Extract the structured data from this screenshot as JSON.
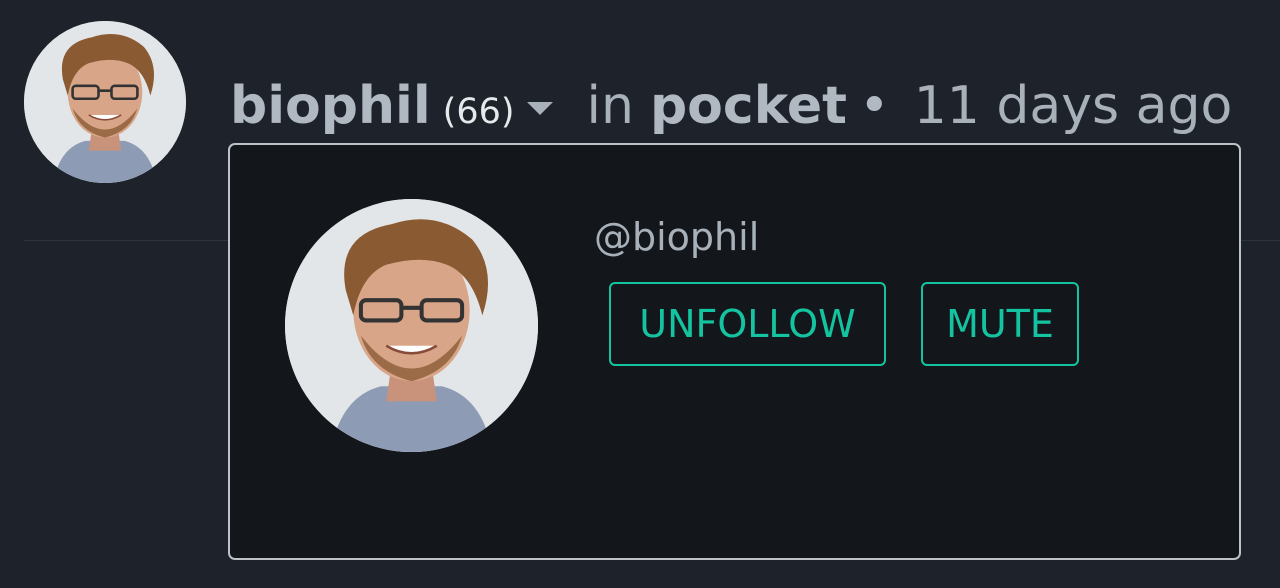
{
  "post_header": {
    "author": "biophil",
    "reputation": "(66)",
    "in_label": "in",
    "community": "pocket",
    "separator_dot": "•",
    "timestamp": "11 days ago"
  },
  "popover": {
    "handle": "@biophil",
    "unfollow_label": "UNFOLLOW",
    "mute_label": "MUTE"
  },
  "icons": {
    "author_menu": "chevron-down-icon"
  },
  "colors": {
    "background": "#1e232b",
    "popover_background": "#13171c",
    "popover_border": "#bcc2c7",
    "accent": "#14c3a0",
    "text_muted": "#a8b1ba"
  }
}
